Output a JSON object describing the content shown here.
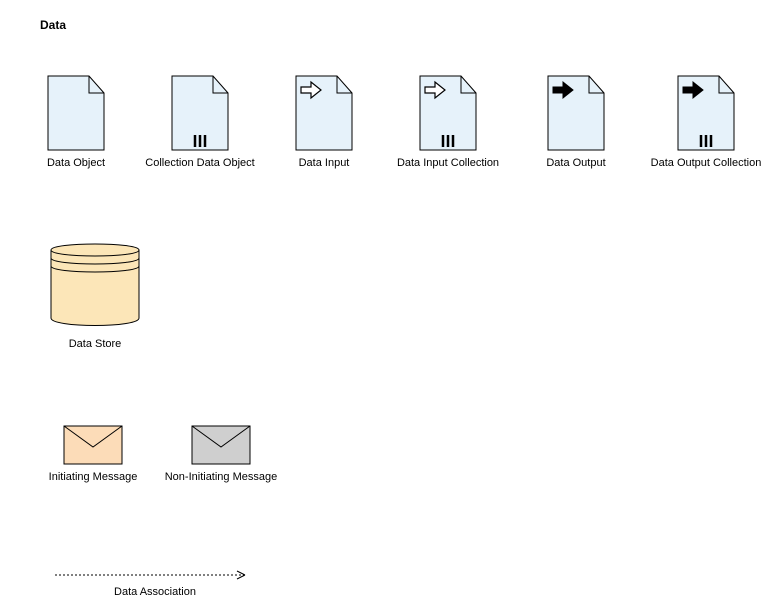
{
  "header": {
    "title": "Data"
  },
  "row1": [
    {
      "label": "Data Object"
    },
    {
      "label": "Collection Data Object"
    },
    {
      "label": "Data Input"
    },
    {
      "label": "Data Input Collection"
    },
    {
      "label": "Data Output"
    },
    {
      "label": "Data Output Collection"
    }
  ],
  "row2": [
    {
      "label": "Data Store"
    }
  ],
  "row3": [
    {
      "label": "Initiating Message"
    },
    {
      "label": "Non-Initiating Message"
    }
  ],
  "association": {
    "label": "Data Association"
  },
  "colors": {
    "docFill": "#e6f2fa",
    "docStroke": "#000000",
    "cylFill": "#fce6b8",
    "cylStroke": "#000000",
    "envInitFill": "#fcdcb8",
    "envNonInitFill": "#cfcfcf",
    "envStroke": "#000000"
  }
}
